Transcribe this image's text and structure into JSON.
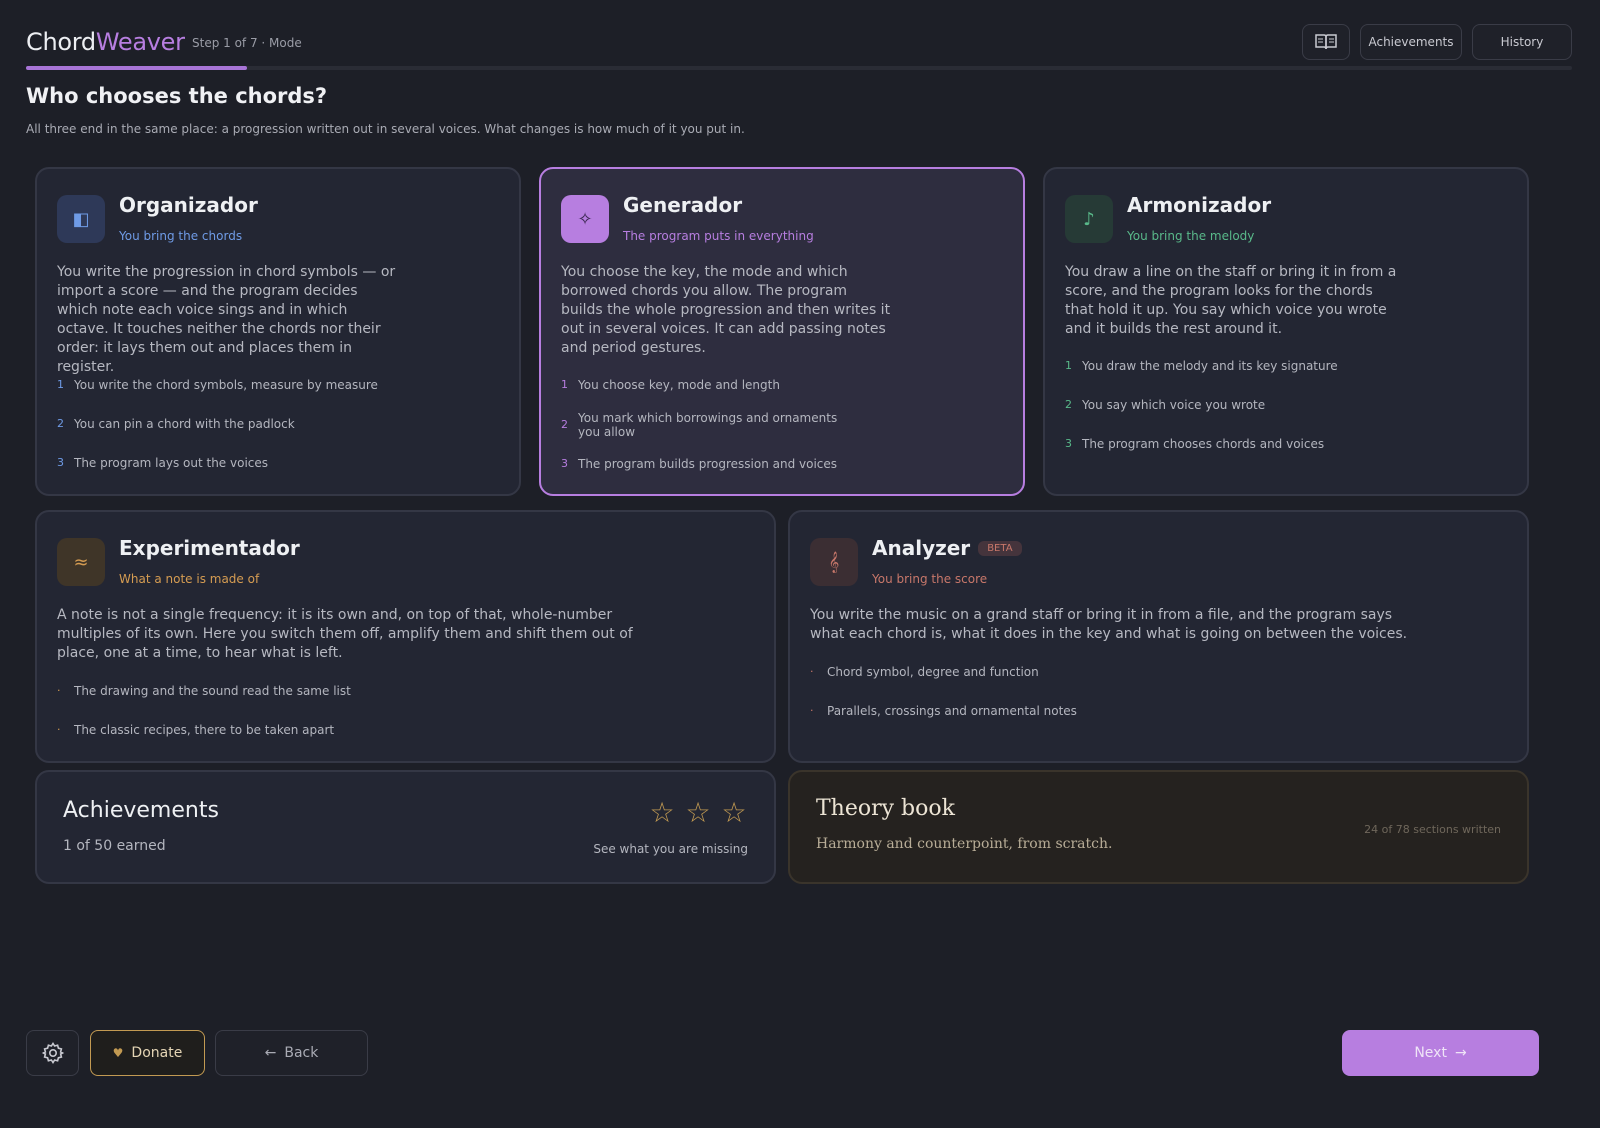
{
  "header": {
    "brand_a": "Chord",
    "brand_b": "Weaver",
    "step": "Step 1 of 7 · Mode",
    "book_icon": "book-icon",
    "achievements_label": "Achievements",
    "history_label": "History",
    "progress": 0.143
  },
  "page": {
    "title": "Who chooses the chords?",
    "subtitle": "All three end in the same place: a progression written out in several voices. What changes is how much of it you put in."
  },
  "cards": {
    "organizador": {
      "icon": "panel-icon",
      "title": "Organizador",
      "tag": "You bring the chords",
      "desc": "You write the progression in chord symbols — or import a score — and the program decides which note each voice sings and in which octave. It touches neither the chords nor their order: it lays them out and places them in register.",
      "steps": [
        {
          "n": "1",
          "text": "You write the chord symbols, measure by measure"
        },
        {
          "n": "2",
          "text": "You can pin a chord with the padlock"
        },
        {
          "n": "3",
          "text": "The program lays out the voices"
        }
      ]
    },
    "generador": {
      "icon": "sparkle-icon",
      "title": "Generador",
      "tag": "The program puts in everything",
      "desc": "You choose the key, the mode and which borrowed chords you allow. The program builds the whole progression and then writes it out in several voices. It can add passing notes and period gestures.",
      "steps": [
        {
          "n": "1",
          "text": "You choose key, mode and length"
        },
        {
          "n": "2",
          "text": "You mark which borrowings and ornaments you allow"
        },
        {
          "n": "3",
          "text": "The program builds progression and voices"
        }
      ]
    },
    "armonizador": {
      "icon": "music-note-icon",
      "title": "Armonizador",
      "tag": "You bring the melody",
      "desc": "You draw a line on the staff or bring it in from a score, and the program looks for the chords that hold it up. You say which voice you wrote and it builds the rest around it.",
      "steps": [
        {
          "n": "1",
          "text": "You draw the melody and its key signature"
        },
        {
          "n": "2",
          "text": "You say which voice you wrote"
        },
        {
          "n": "3",
          "text": "The program chooses chords and voices"
        }
      ]
    },
    "experimentador": {
      "icon": "wave-icon",
      "title": "Experimentador",
      "tag": "What a note is made of",
      "desc": "A note is not a single frequency: it is its own and, on top of that, whole-number multiples of its own. Here you switch them off, amplify them and shift them out of place, one at a time, to hear what is left.",
      "bullets": [
        {
          "n": "·",
          "text": "The drawing and the sound read the same list"
        },
        {
          "n": "·",
          "text": "The classic recipes, there to be taken apart"
        }
      ]
    },
    "analyzer": {
      "icon": "treble-clef-icon",
      "title": "Analyzer",
      "badge": "BETA",
      "tag": "You bring the score",
      "desc": "You write the music on a grand staff or bring it in from a file, and the program says what each chord is, what it does in the key and what is going on between the voices.",
      "bullets": [
        {
          "n": "·",
          "text": "Chord symbol, degree and function"
        },
        {
          "n": "·",
          "text": "Parallels, crossings and ornamental notes"
        }
      ]
    },
    "achievements": {
      "title": "Achievements",
      "count": "1 of 50 earned",
      "link": "See what you are missing",
      "star_icon": "star-outline-icon"
    },
    "theory": {
      "title": "Theory book",
      "subtitle": "Harmony and counterpoint, from scratch.",
      "progress": "24 of 78 sections written"
    }
  },
  "footer": {
    "settings_icon": "gear-icon",
    "donate_label": "Donate",
    "back_label": "Back",
    "next_label": "Next"
  },
  "colors": {
    "accent": "#b77ee0",
    "blue": "#6f9be6",
    "green": "#59b98a",
    "orange": "#d59c52",
    "red": "#c7776a",
    "gold": "#c29a52"
  }
}
